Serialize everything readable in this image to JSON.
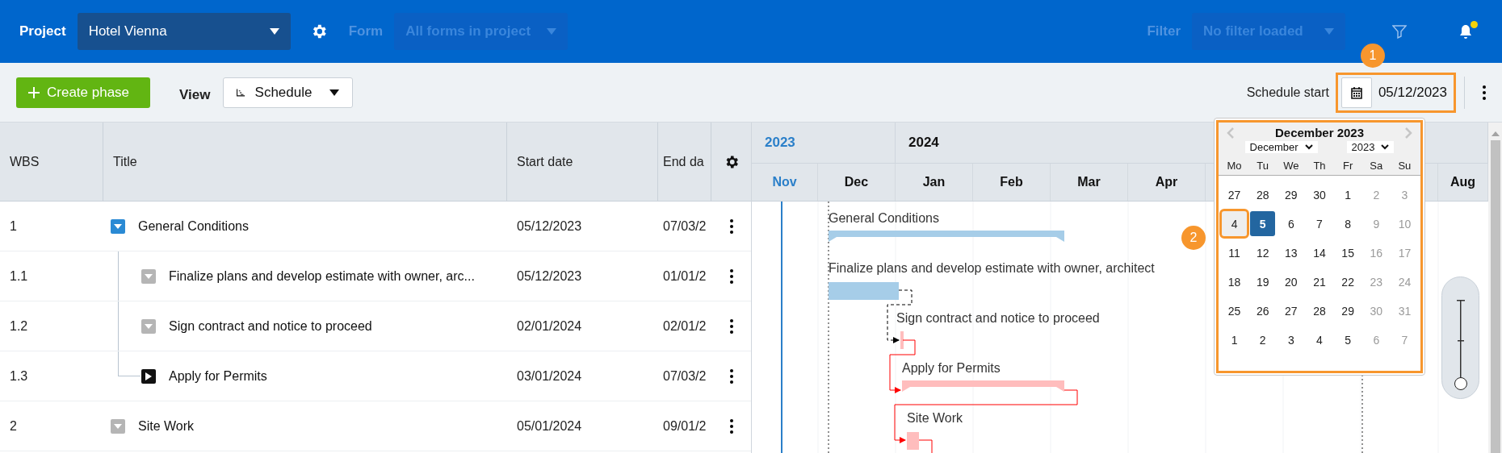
{
  "header": {
    "project_label": "Project",
    "project": "Hotel Vienna",
    "form_label": "Form",
    "form": "All forms in project",
    "filter_label": "Filter",
    "filter": "No filter loaded",
    "unread_notifications": true
  },
  "toolbar": {
    "create_button": "Create phase",
    "view_label": "View",
    "view": "Schedule",
    "schedule_start_label": "Schedule start",
    "schedule_start": "05/12/2023",
    "schedule_start_highlighted": true
  },
  "table": {
    "columns": [
      "WBS",
      "Title",
      "Start date",
      "End da"
    ],
    "rows": [
      {
        "wbs": "1",
        "title": "General Conditions",
        "start": "05/12/2023",
        "end": "07/03/2",
        "expandable": true,
        "expanded": true,
        "children": [
          {
            "wbs": "1.1",
            "title": "Finalize plans and develop estimate with owner, arc...",
            "start": "05/12/2023",
            "end": "01/01/2",
            "expandable": false
          },
          {
            "wbs": "1.2",
            "title": "Sign contract and notice to proceed",
            "start": "02/01/2024",
            "end": "02/01/2",
            "expandable": false
          },
          {
            "wbs": "1.3",
            "title": "Apply for Permits",
            "start": "03/01/2024",
            "end": "07/03/2",
            "expandable": true,
            "expanded": false
          }
        ]
      },
      {
        "wbs": "2",
        "title": "Site Work",
        "start": "05/01/2024",
        "end": "09/01/2",
        "expandable": false
      }
    ]
  },
  "timeline": {
    "years": [
      {
        "label": "2023",
        "current": true
      },
      {
        "label": "2024",
        "current": false
      }
    ],
    "months": [
      {
        "label": "Nov",
        "current": true
      },
      {
        "label": "Dec",
        "current": false
      },
      {
        "label": "Jan",
        "current": false
      },
      {
        "label": "Feb",
        "current": false
      },
      {
        "label": "Mar",
        "current": false
      },
      {
        "label": "Apr",
        "current": false
      },
      {
        "label": "Aug",
        "current": false
      }
    ],
    "tasks": [
      {
        "label": "General Conditions",
        "kind": "summary",
        "critical": false
      },
      {
        "label": "Finalize plans and develop estimate with owner, architect",
        "kind": "task",
        "critical": false
      },
      {
        "label": "Sign contract and notice to proceed",
        "kind": "milestone",
        "critical": true
      },
      {
        "label": "Apply for Permits",
        "kind": "summary",
        "critical": true
      },
      {
        "label": "Site Work",
        "kind": "task",
        "critical": true
      }
    ],
    "zoom": {
      "level": 0
    }
  },
  "calendar": {
    "title": "December 2023",
    "month": "December",
    "year": "2023",
    "highlighted": true,
    "weekdays": [
      "Mo",
      "Tu",
      "We",
      "Th",
      "Fr",
      "Sa",
      "Su"
    ],
    "weeks": [
      [
        {
          "day": "27",
          "muted": false,
          "selected": false,
          "highlighted": false
        },
        {
          "day": "28",
          "muted": false,
          "selected": false,
          "highlighted": false
        },
        {
          "day": "29",
          "muted": false,
          "selected": false,
          "highlighted": false
        },
        {
          "day": "30",
          "muted": false,
          "selected": false,
          "highlighted": false
        },
        {
          "day": "1",
          "muted": false,
          "selected": false,
          "highlighted": false
        },
        {
          "day": "2",
          "muted": true,
          "selected": false,
          "highlighted": false
        },
        {
          "day": "3",
          "muted": true,
          "selected": false,
          "highlighted": false
        }
      ],
      [
        {
          "day": "4",
          "muted": false,
          "selected": false,
          "highlighted": true
        },
        {
          "day": "5",
          "muted": false,
          "selected": true,
          "highlighted": false
        },
        {
          "day": "6",
          "muted": false,
          "selected": false,
          "highlighted": false
        },
        {
          "day": "7",
          "muted": false,
          "selected": false,
          "highlighted": false
        },
        {
          "day": "8",
          "muted": false,
          "selected": false,
          "highlighted": false
        },
        {
          "day": "9",
          "muted": true,
          "selected": false,
          "highlighted": false
        },
        {
          "day": "10",
          "muted": true,
          "selected": false,
          "highlighted": false
        }
      ],
      [
        {
          "day": "11",
          "muted": false,
          "selected": false,
          "highlighted": false
        },
        {
          "day": "12",
          "muted": false,
          "selected": false,
          "highlighted": false
        },
        {
          "day": "13",
          "muted": false,
          "selected": false,
          "highlighted": false
        },
        {
          "day": "14",
          "muted": false,
          "selected": false,
          "highlighted": false
        },
        {
          "day": "15",
          "muted": false,
          "selected": false,
          "highlighted": false
        },
        {
          "day": "16",
          "muted": true,
          "selected": false,
          "highlighted": false
        },
        {
          "day": "17",
          "muted": true,
          "selected": false,
          "highlighted": false
        }
      ],
      [
        {
          "day": "18",
          "muted": false,
          "selected": false,
          "highlighted": false
        },
        {
          "day": "19",
          "muted": false,
          "selected": false,
          "highlighted": false
        },
        {
          "day": "20",
          "muted": false,
          "selected": false,
          "highlighted": false
        },
        {
          "day": "21",
          "muted": false,
          "selected": false,
          "highlighted": false
        },
        {
          "day": "22",
          "muted": false,
          "selected": false,
          "highlighted": false
        },
        {
          "day": "23",
          "muted": true,
          "selected": false,
          "highlighted": false
        },
        {
          "day": "24",
          "muted": true,
          "selected": false,
          "highlighted": false
        }
      ],
      [
        {
          "day": "25",
          "muted": false,
          "selected": false,
          "highlighted": false
        },
        {
          "day": "26",
          "muted": false,
          "selected": false,
          "highlighted": false
        },
        {
          "day": "27",
          "muted": false,
          "selected": false,
          "highlighted": false
        },
        {
          "day": "28",
          "muted": false,
          "selected": false,
          "highlighted": false
        },
        {
          "day": "29",
          "muted": false,
          "selected": false,
          "highlighted": false
        },
        {
          "day": "30",
          "muted": true,
          "selected": false,
          "highlighted": false
        },
        {
          "day": "31",
          "muted": true,
          "selected": false,
          "highlighted": false
        }
      ],
      [
        {
          "day": "1",
          "muted": false,
          "selected": false,
          "highlighted": false
        },
        {
          "day": "2",
          "muted": false,
          "selected": false,
          "highlighted": false
        },
        {
          "day": "3",
          "muted": false,
          "selected": false,
          "highlighted": false
        },
        {
          "day": "4",
          "muted": false,
          "selected": false,
          "highlighted": false
        },
        {
          "day": "5",
          "muted": false,
          "selected": false,
          "highlighted": false
        },
        {
          "day": "6",
          "muted": true,
          "selected": false,
          "highlighted": false
        },
        {
          "day": "7",
          "muted": true,
          "selected": false,
          "highlighted": false
        }
      ]
    ]
  },
  "callouts": [
    {
      "label": "1"
    },
    {
      "label": "2"
    }
  ]
}
